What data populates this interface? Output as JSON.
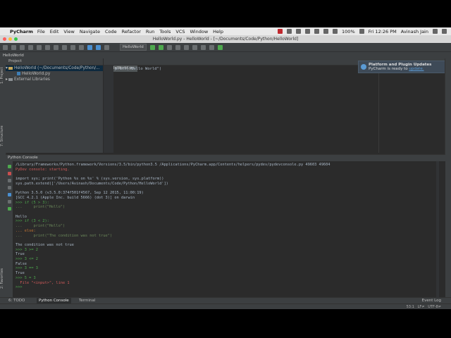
{
  "menubar": {
    "app": "PyCharm",
    "items": [
      "File",
      "Edit",
      "View",
      "Navigate",
      "Code",
      "Refactor",
      "Run",
      "Tools",
      "VCS",
      "Window",
      "Help"
    ],
    "battery": "100%",
    "clock": "Fri 12:26 PM",
    "user": "Avinash Jain"
  },
  "window": {
    "title": "HelloWorld.py - HelloWorld - [~/Documents/Code/Python/HelloWorld]"
  },
  "toolbar": {
    "run_config": "HelloWorld"
  },
  "navbar": {
    "project": "HelloWorld"
  },
  "left_tabs": {
    "project": "1: Project",
    "structure": "7: Structure",
    "favorites": "2: Favorites"
  },
  "project_panel": {
    "header": "Project",
    "root": "HelloWorld (~/Documents/Code/Python/...",
    "file": "HelloWorld.py",
    "external": "External Libraries"
  },
  "editor": {
    "tab": "HelloWorld.py",
    "code": "print(\"Hello World\")"
  },
  "notification": {
    "title": "Platform and Plugin Updates",
    "text": "PyCharm is ready to",
    "link": "update."
  },
  "console": {
    "header": "Python Console",
    "line_cmd": "/Library/Frameworks/Python.framework/Versions/3.5/bin/python3.5 /Applications/PyCharm.app/Contents/helpers/pydev/pydevconsole.py 49603 49604",
    "line_start": "PyDev console: starting.",
    "line_imp1": "import sys; print('Python %s on %s' % (sys.version, sys.platform))",
    "line_imp2": "sys.path.extend(['/Users/Avinash/Documents/Code/Python/HelloWorld'])",
    "line_ver1": "Python 3.5.0 (v3.5.0:374f501f4567, Sep 12 2015, 11:00:19)",
    "line_ver2": "[GCC 4.2.1 (Apple Inc. build 5666) (dot 3)] on darwin",
    "l1": ">>> if (5 > 3):",
    "l2": "...     print(\"Hello\")",
    "l3": "Hello",
    "l4": ">>> if (3 < 2):",
    "l5": "...     print(\"Hello\")",
    "l6": "... else:",
    "l7": "...     print(\"The condition was not true\")",
    "l8": "The condition was not true",
    "l9": ">>> 3 >= 2",
    "l10": "True",
    "l11": ">>> 3 <= 2",
    "l12": "False",
    "l13": ">>> 3 == 3",
    "l14": "True",
    "l15": ">>> 5 = 3",
    "l16": "  File \"<input>\", line 1",
    "l17": ">>>"
  },
  "bottom_tabs": {
    "todo": "6: TODO",
    "console": "Python Console",
    "terminal": "Terminal",
    "event_log": "Event Log"
  },
  "status": {
    "position": "53:1",
    "line_sep": "LF≠",
    "encoding": "UTF-8≠"
  }
}
